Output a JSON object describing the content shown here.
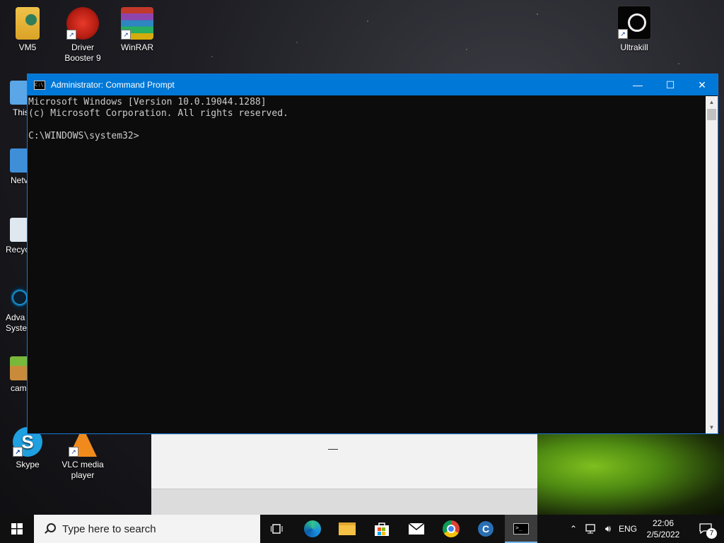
{
  "desktop": {
    "icons": [
      {
        "label": "VM5"
      },
      {
        "label": "Driver Booster 9"
      },
      {
        "label": "WinRAR"
      },
      {
        "label": "Ultrakill"
      },
      {
        "label": "Skype"
      },
      {
        "label": "VLC media player"
      }
    ],
    "partial_icons": [
      {
        "label": "This"
      },
      {
        "label": "Netv"
      },
      {
        "label": "Recyc"
      },
      {
        "label": "Adva\nSyster"
      },
      {
        "label": "cam"
      }
    ]
  },
  "window": {
    "title": "Administrator: Command Prompt",
    "controls": {
      "minimize": "—",
      "maximize": "☐",
      "close": "✕"
    },
    "console_text": "Microsoft Windows [Version 10.0.19044.1288]\n(c) Microsoft Corporation. All rights reserved.\n\nC:\\WINDOWS\\system32>"
  },
  "taskbar": {
    "search_placeholder": "Type here to search",
    "apps": [
      "task-view",
      "edge",
      "file-explorer",
      "microsoft-store",
      "mail",
      "chrome",
      "ccleaner",
      "command-prompt"
    ],
    "language": "ENG",
    "time": "22:06",
    "date": "2/5/2022",
    "notification_count": "7"
  },
  "colors": {
    "titlebar": "#0078d7",
    "console_bg": "#0c0c0c",
    "console_text": "#cccccc",
    "taskbar": "#101010"
  }
}
